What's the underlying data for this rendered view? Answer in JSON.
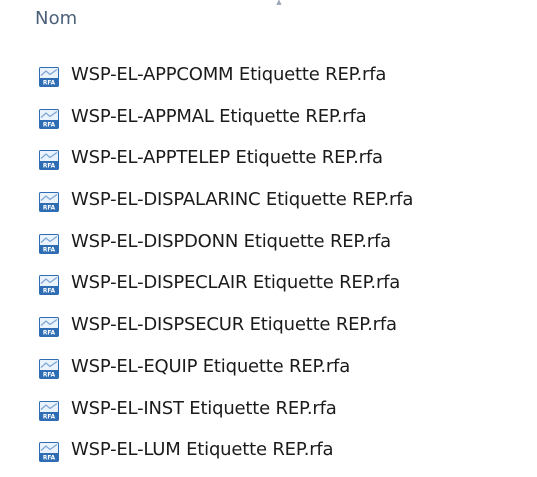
{
  "header": {
    "column_label": "Nom",
    "sort_indicator_icon": "sort-ascending-chevron-icon"
  },
  "files": [
    {
      "name": "WSP-EL-APPCOMM Etiquette REP.rfa",
      "icon": "rfa-file-icon",
      "icon_text": "RFA"
    },
    {
      "name": "WSP-EL-APPMAL Etiquette REP.rfa",
      "icon": "rfa-file-icon",
      "icon_text": "RFA"
    },
    {
      "name": "WSP-EL-APPTELEP Etiquette REP.rfa",
      "icon": "rfa-file-icon",
      "icon_text": "RFA"
    },
    {
      "name": "WSP-EL-DISPALARINC Etiquette REP.rfa",
      "icon": "rfa-file-icon",
      "icon_text": "RFA"
    },
    {
      "name": "WSP-EL-DISPDONN Etiquette REP.rfa",
      "icon": "rfa-file-icon",
      "icon_text": "RFA"
    },
    {
      "name": "WSP-EL-DISPECLAIR Etiquette REP.rfa",
      "icon": "rfa-file-icon",
      "icon_text": "RFA"
    },
    {
      "name": "WSP-EL-DISPSECUR Etiquette REP.rfa",
      "icon": "rfa-file-icon",
      "icon_text": "RFA"
    },
    {
      "name": "WSP-EL-EQUIP Etiquette REP.rfa",
      "icon": "rfa-file-icon",
      "icon_text": "RFA"
    },
    {
      "name": "WSP-EL-INST Etiquette REP.rfa",
      "icon": "rfa-file-icon",
      "icon_text": "RFA"
    },
    {
      "name": "WSP-EL-LUM Etiquette REP.rfa",
      "icon": "rfa-file-icon",
      "icon_text": "RFA"
    }
  ],
  "colors": {
    "header_text": "#4c607a",
    "file_text": "#1b1b1b",
    "icon_blue": "#2e6db4",
    "icon_dark_blue": "#1f4f8f",
    "icon_light": "#eaf2fb"
  }
}
